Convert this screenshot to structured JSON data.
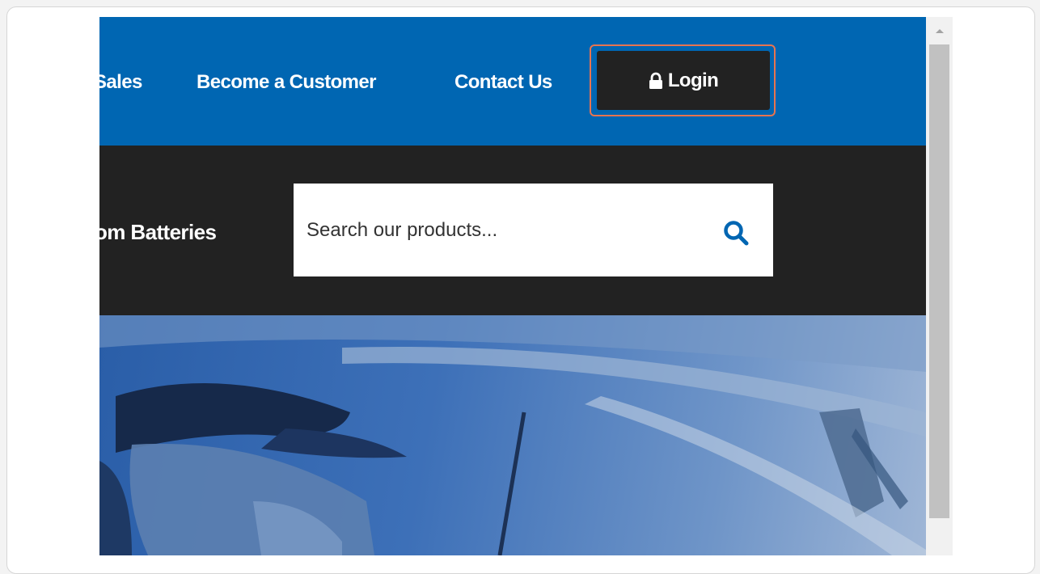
{
  "nav": {
    "items": [
      {
        "label": "Sales"
      },
      {
        "label": "Become a Customer"
      },
      {
        "label": "Contact Us"
      }
    ],
    "login_label": "Login"
  },
  "categories": {
    "visible_item": "om Batteries"
  },
  "search": {
    "placeholder": "Search our products..."
  },
  "icons": {
    "lock": "lock-icon",
    "search": "search-icon",
    "scroll_up": "chevron-up-icon"
  },
  "colors": {
    "nav_bg": "#0066b2",
    "search_band_bg": "#222222",
    "login_bg": "#222222",
    "highlight_ring": "#e8744f",
    "search_icon": "#0066b2"
  }
}
